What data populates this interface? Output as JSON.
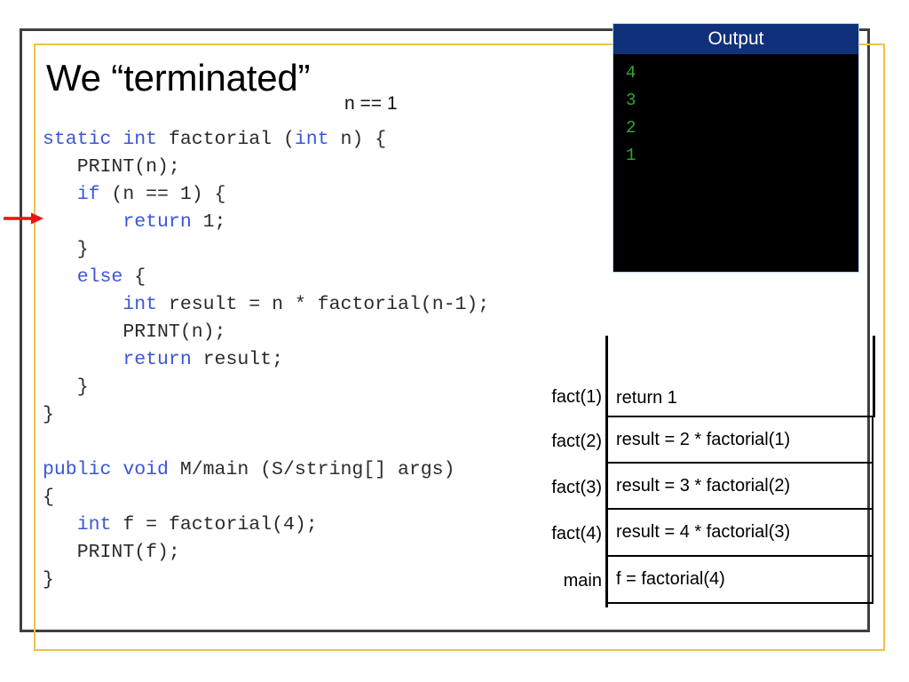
{
  "slide": {
    "title": "We “terminated”",
    "annotation": "n == 1"
  },
  "code": {
    "language": "java",
    "lines": [
      [
        {
          "t": "static int ",
          "k": true
        },
        {
          "t": "factorial (",
          "k": false
        },
        {
          "t": "int",
          "k": true
        },
        {
          "t": " n) {",
          "k": false
        }
      ],
      [
        {
          "t": "   PRINT(n);",
          "k": false
        }
      ],
      [
        {
          "t": "   ",
          "k": false
        },
        {
          "t": "if",
          "k": true
        },
        {
          "t": " (n == 1) {",
          "k": false
        }
      ],
      [
        {
          "t": "       ",
          "k": false
        },
        {
          "t": "return",
          "k": true
        },
        {
          "t": " 1;",
          "k": false
        }
      ],
      [
        {
          "t": "   }",
          "k": false
        }
      ],
      [
        {
          "t": "   ",
          "k": false
        },
        {
          "t": "else",
          "k": true
        },
        {
          "t": " {",
          "k": false
        }
      ],
      [
        {
          "t": "       ",
          "k": false
        },
        {
          "t": "int",
          "k": true
        },
        {
          "t": " result = n * factorial(n-1);",
          "k": false
        }
      ],
      [
        {
          "t": "       PRINT(n);",
          "k": false
        }
      ],
      [
        {
          "t": "       ",
          "k": false
        },
        {
          "t": "return",
          "k": true
        },
        {
          "t": " result;",
          "k": false
        }
      ],
      [
        {
          "t": "   }",
          "k": false
        }
      ],
      [
        {
          "t": "}",
          "k": false
        }
      ],
      [
        {
          "t": "",
          "k": false
        }
      ],
      [
        {
          "t": "public void",
          "k": true
        },
        {
          "t": " M/main (S/string[] args)",
          "k": false
        }
      ],
      [
        {
          "t": "{",
          "k": false
        }
      ],
      [
        {
          "t": "   ",
          "k": false
        },
        {
          "t": "int",
          "k": true
        },
        {
          "t": " f = factorial(4);",
          "k": false
        }
      ],
      [
        {
          "t": "   PRINT(f);",
          "k": false
        }
      ],
      [
        {
          "t": "}",
          "k": false
        }
      ]
    ]
  },
  "output": {
    "title": "Output",
    "lines": [
      "4",
      "3",
      "2",
      "1"
    ],
    "text_color": "#2fa82f",
    "header_color": "#10307a",
    "background_color": "#000000"
  },
  "callstack": {
    "frames": [
      {
        "label": "fact(1)",
        "body": "return 1"
      },
      {
        "label": "fact(2)",
        "body": "result = 2 * factorial(1)"
      },
      {
        "label": "fact(3)",
        "body": "result = 3 * factorial(2)"
      },
      {
        "label": "fact(4)",
        "body": "result = 4 * factorial(3)"
      },
      {
        "label": "main",
        "body": "f = factorial(4)"
      }
    ]
  },
  "pointer": {
    "name": "red-arrow",
    "color": "#ee1111",
    "points_to": "return 1"
  },
  "frames": {
    "outer_border_color": "#3f3f3f",
    "inner_border_color": "#f0c14b"
  }
}
